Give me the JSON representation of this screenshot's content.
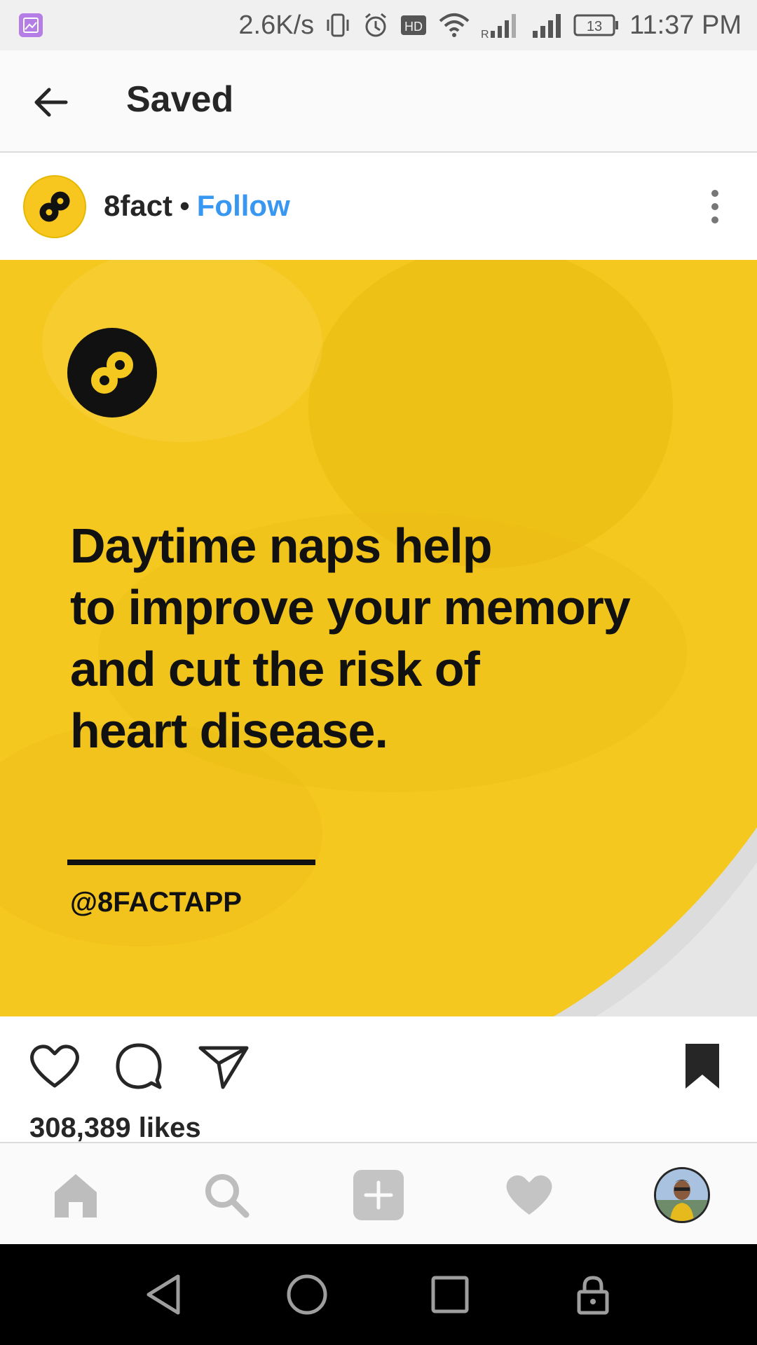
{
  "status_bar": {
    "speed": "2.6K/s",
    "hd_badge": "HD",
    "signal_label": "R",
    "battery": "13",
    "time": "11:37 PM",
    "icons": [
      "gallery-icon",
      "vibrate-icon",
      "alarm-icon",
      "hd-icon",
      "wifi-icon",
      "signal-icon",
      "signal-icon-2",
      "battery-icon"
    ]
  },
  "header": {
    "title": "Saved"
  },
  "post": {
    "username": "8fact",
    "separator": "•",
    "follow_label": "Follow",
    "headline_lines": [
      "Daytime naps help",
      "to improve your memory",
      "and cut the risk of",
      "heart disease."
    ],
    "handle": "@8FACTAPP",
    "likes": "308,389 likes",
    "accent_color": "#f3c51a",
    "link_color": "#3897f0"
  },
  "bottom_nav": {
    "items": [
      "home-icon",
      "search-icon",
      "add-icon",
      "activity-heart-icon",
      "profile-avatar"
    ]
  },
  "system_nav": {
    "items": [
      "back-icon",
      "home-icon",
      "recents-icon",
      "lock-icon"
    ]
  }
}
